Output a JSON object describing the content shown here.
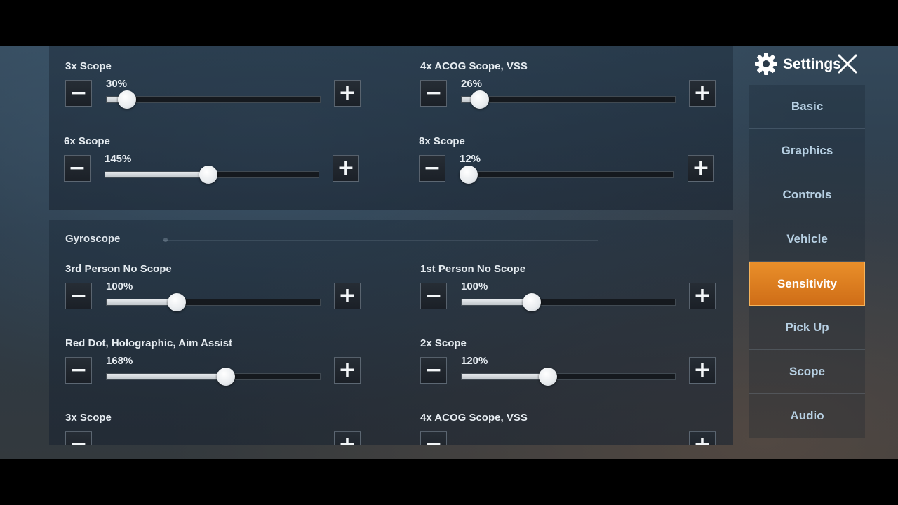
{
  "sidebar": {
    "title": "Settings",
    "items": [
      {
        "label": "Basic",
        "active": false
      },
      {
        "label": "Graphics",
        "active": false
      },
      {
        "label": "Controls",
        "active": false
      },
      {
        "label": "Vehicle",
        "active": false
      },
      {
        "label": "Sensitivity",
        "active": true
      },
      {
        "label": "Pick Up",
        "active": false
      },
      {
        "label": "Scope",
        "active": false
      },
      {
        "label": "Audio",
        "active": false
      }
    ]
  },
  "camera_sliders": [
    {
      "label": "3x Scope",
      "value": "30%",
      "fraction": 0.095
    },
    {
      "label": "4x ACOG Scope, VSS",
      "value": "26%",
      "fraction": 0.085
    },
    {
      "label": "6x Scope",
      "value": "145%",
      "fraction": 0.485
    },
    {
      "label": "8x Scope",
      "value": "12%",
      "fraction": 0.04
    }
  ],
  "gyroscope": {
    "title": "Gyroscope",
    "sliders": [
      {
        "label": "3rd Person No Scope",
        "value": "100%",
        "fraction": 0.33
      },
      {
        "label": "1st Person No Scope",
        "value": "100%",
        "fraction": 0.33
      },
      {
        "label": "Red Dot, Holographic, Aim Assist",
        "value": "168%",
        "fraction": 0.56
      },
      {
        "label": "2x Scope",
        "value": "120%",
        "fraction": 0.405
      },
      {
        "label": "3x Scope",
        "value": "",
        "fraction": null
      },
      {
        "label": "4x ACOG Scope, VSS",
        "value": "",
        "fraction": null
      }
    ]
  },
  "glyphs": {
    "minus": "−",
    "plus": "+"
  },
  "colors": {
    "accent": "#e3821f",
    "menu_text": "#b7d0e3"
  }
}
